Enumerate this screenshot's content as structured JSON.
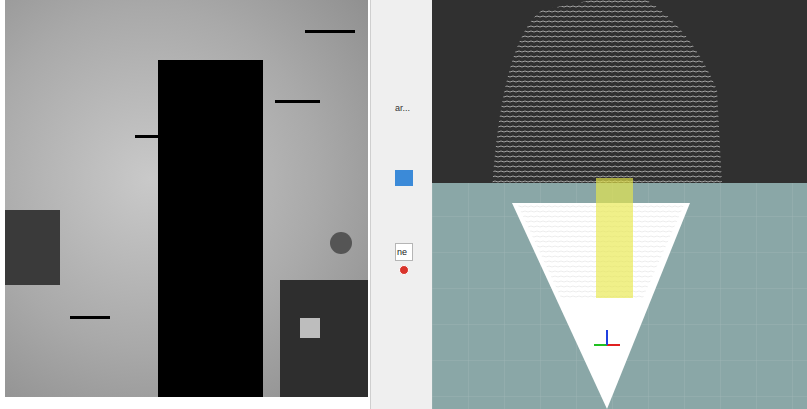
{
  "side_panel": {
    "truncated_label": "ar...",
    "button": "ne"
  }
}
